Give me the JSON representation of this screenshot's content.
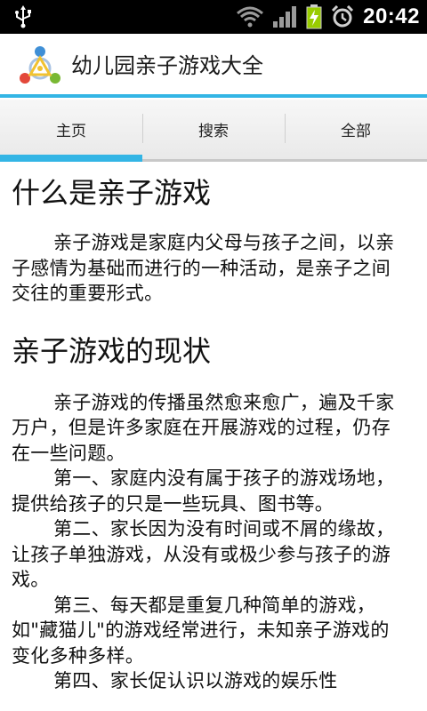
{
  "status_bar": {
    "time": "20:42",
    "icons": [
      "usb-icon",
      "wifi-icon",
      "signal-icon",
      "battery-charging-icon",
      "alarm-icon"
    ]
  },
  "app": {
    "title": "幼儿园亲子游戏大全",
    "logo": "app-logo-icon"
  },
  "tabs": [
    {
      "label": "主页",
      "selected": true
    },
    {
      "label": "搜索",
      "selected": false
    },
    {
      "label": "全部",
      "selected": false
    }
  ],
  "article": {
    "heading1": "什么是亲子游戏",
    "intro": "亲子游戏是家庭内父母与孩子之间，以亲子感情为基础而进行的一种活动，是亲子之间交往的重要形式。",
    "heading2": "亲子游戏的现状",
    "paragraphs": [
      "亲子游戏的传播虽然愈来愈广，遍及千家万户，但是许多家庭在开展游戏的过程，仍存在一些问题。",
      "第一、家庭内没有属于孩子的游戏场地，提供给孩子的只是一些玩具、图书等。",
      "第二、家长因为没有时间或不屑的缘故，让孩子单独游戏，从没有或极少参与孩子的游戏。",
      "第三、每天都是重复几种简单的游戏，如\"藏猫儿\"的游戏经常进行，未知亲子游戏的变化多种多样。",
      "第四、家长促认识以游戏的娱乐性"
    ]
  },
  "colors": {
    "accent": "#33b5e5",
    "status_bar": "#000000",
    "battery": "#99cc00"
  }
}
